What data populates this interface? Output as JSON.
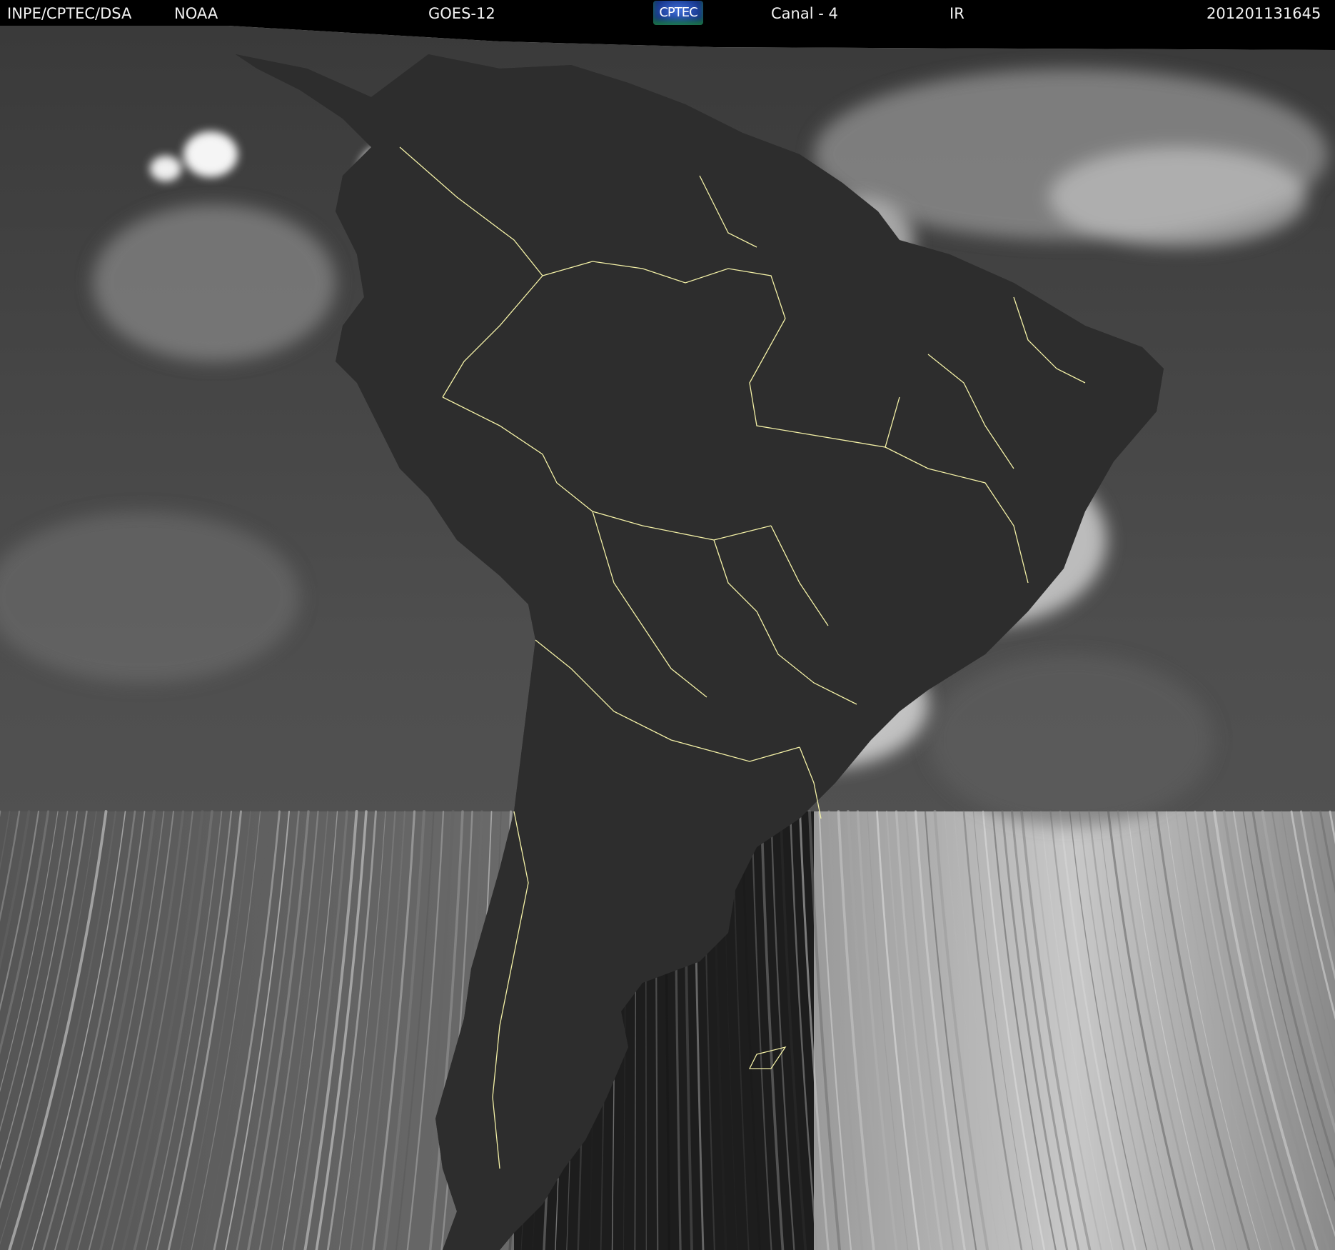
{
  "header": {
    "agency": "INPE/CPTEC/DSA",
    "source": "NOAA",
    "satellite": "GOES-12",
    "logo_text": "CPTEC",
    "channel": "Canal - 4",
    "band": "IR",
    "timestamp": "201201131645"
  },
  "colors": {
    "header_background": "#000000",
    "header_text": "#f2f2f2",
    "coastline": "#f3f0a6",
    "ocean": "#4a4a4a",
    "land": "#2f2f2f",
    "clouds": "#f2f2f2"
  },
  "icons": {
    "logo": "cptec-logo"
  }
}
